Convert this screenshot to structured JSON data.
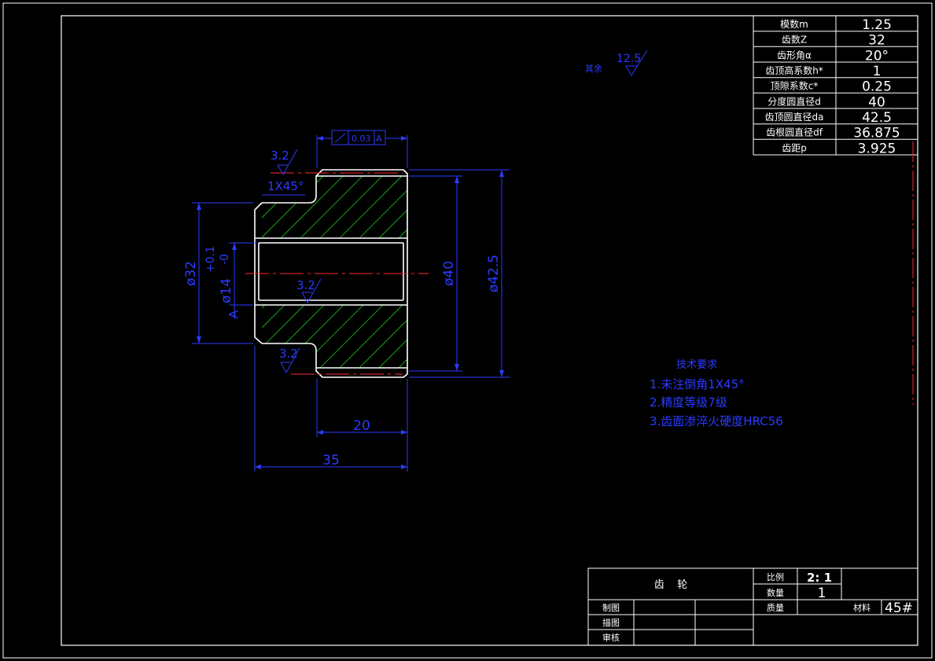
{
  "params": [
    {
      "label": "模数m",
      "value": "1.25"
    },
    {
      "label": "齿数Z",
      "value": "32"
    },
    {
      "label": "齿形角α",
      "value": "20°"
    },
    {
      "label": "齿顶高系数h*",
      "value": "1"
    },
    {
      "label": "顶隙系数c*",
      "value": "0.25"
    },
    {
      "label": "分度圆直径d",
      "value": "40"
    },
    {
      "label": "齿顶圆直径da",
      "value": "42.5"
    },
    {
      "label": "齿根圆直径df",
      "value": "36.875"
    },
    {
      "label": "齿距p",
      "value": "3.925"
    }
  ],
  "surface_rest": {
    "label": "其余",
    "value": "12.5"
  },
  "tolerance_frame": {
    "symbol": "↗",
    "value": "0.03",
    "datum": "A"
  },
  "dims": {
    "chamfer": "1X45°",
    "roughness_top": "3.2",
    "roughness_bore": "3.2",
    "roughness_bottom": "3.2",
    "d32": "ø32",
    "tol_upper": "+0.1",
    "tol_lower": "-0",
    "d14": "ø14",
    "d40": "ø40",
    "d42_5": "ø42.5",
    "len20": "20",
    "len35": "35",
    "datum_label": "A"
  },
  "tech": {
    "title": "技术要求",
    "items": [
      "1.未注倒角1X45°",
      "2.精度等级7级",
      "3.齿面渗淬火硬度HRC56"
    ]
  },
  "title_block": {
    "part_name": "齿    轮",
    "scale_label": "比例",
    "scale_value": "2: 1",
    "qty_label": "数量",
    "qty_value": "1",
    "mass_label": "质量",
    "material_label": "材料",
    "material_value": "45#",
    "made_label": "制图",
    "drawn_label": "描图",
    "check_label": "审核"
  }
}
